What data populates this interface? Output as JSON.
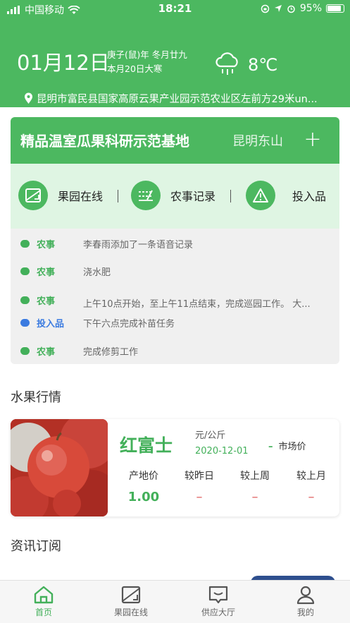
{
  "status_bar": {
    "carrier": "中国移动",
    "time": "18:21",
    "battery": "95%"
  },
  "header": {
    "date": "01月12日",
    "lunar_line1": "庚子(鼠)年 冬月廿九",
    "lunar_line2": "本月20日大寒",
    "weather_icon": "cloud-rain-icon",
    "temperature": "8℃",
    "location": "昆明市富民县国家高原云果产业园示范农业区左前方29米un..."
  },
  "base_card": {
    "title": "精品温室瓜果科研示范基地",
    "subtitle": "昆明东山",
    "add_symbol": "+"
  },
  "quick_actions": [
    {
      "label": "果园在线",
      "icon": "orchard-monitor-icon"
    },
    {
      "label": "农事记录",
      "icon": "farm-record-icon"
    },
    {
      "label": "投入品",
      "icon": "warning-triangle-icon"
    }
  ],
  "activity_log": [
    {
      "type": "农事",
      "text": "李春雨添加了一条语音记录",
      "color": "#43b05a"
    },
    {
      "type": "农事",
      "text": "浇水肥",
      "color": "#43b05a"
    },
    {
      "type": "农事",
      "text": "上午10点开始，至上午11点结束，完成巡园工作。 大...",
      "color": "#43b05a"
    },
    {
      "type": "投入品",
      "text": "下午六点完成补苗任务",
      "color": "#3b7be0"
    },
    {
      "type": "农事",
      "text": "完成修剪工作",
      "color": "#43b05a"
    }
  ],
  "market_section": {
    "title": "水果行情",
    "fruit": {
      "name": "红富士",
      "unit": "元/公斤",
      "date": "2020-12-01",
      "market_dash": "–",
      "market_label": "市场价",
      "prices": [
        {
          "label": "产地价",
          "value": "1.00"
        },
        {
          "label": "较昨日",
          "value": "–"
        },
        {
          "label": "较上周",
          "value": "–"
        },
        {
          "label": "较上月",
          "value": "–"
        }
      ]
    }
  },
  "news_section": {
    "title": "资讯订阅"
  },
  "tab_bar": [
    {
      "label": "首页",
      "icon": "home-icon",
      "active": true
    },
    {
      "label": "果园在线",
      "icon": "orchard-monitor-icon",
      "active": false
    },
    {
      "label": "供应大厅",
      "icon": "supply-message-icon",
      "active": false
    },
    {
      "label": "我的",
      "icon": "user-icon",
      "active": false
    }
  ],
  "colors": {
    "brand_green": "#4cb860",
    "light_green": "#dff5e3",
    "input_blue": "#3b7be0",
    "dash_red": "#e06060"
  }
}
